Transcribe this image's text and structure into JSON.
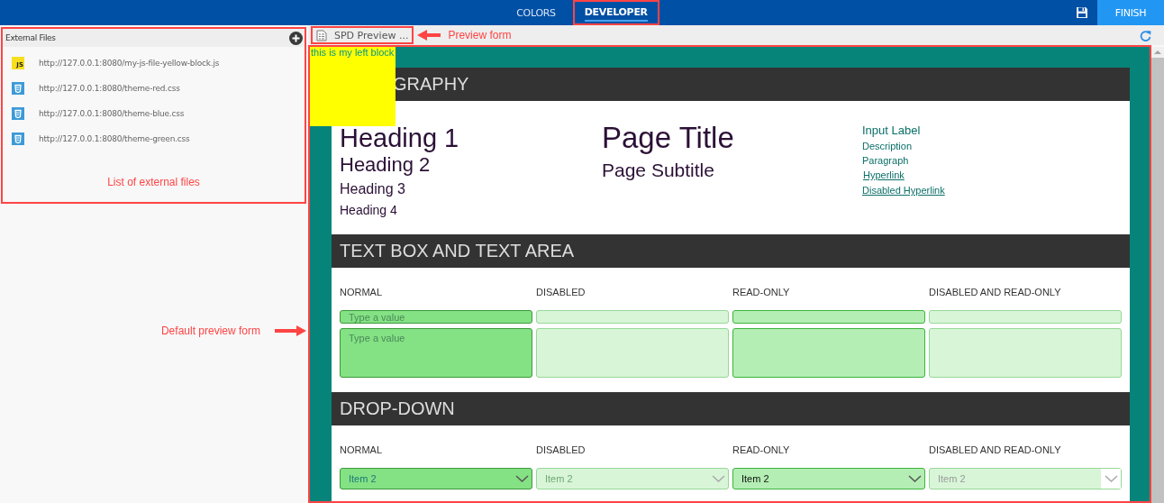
{
  "topbar": {
    "tabs": [
      {
        "label": "COLORS",
        "selected": false,
        "highlighted": false
      },
      {
        "label": "DEVELOPER",
        "selected": true,
        "highlighted": true
      }
    ],
    "finish_button": "FINISH"
  },
  "external_files": {
    "title": "External Files",
    "highlighted": true,
    "files": [
      {
        "kind": "js",
        "badge": "JS",
        "url": "http://127.0.0.1:8080/my-js-file-yellow-block.js"
      },
      {
        "kind": "css",
        "url": "http://127.0.0.1:8080/theme-red.css"
      },
      {
        "kind": "css",
        "url": "http://127.0.0.1:8080/theme-blue.css"
      },
      {
        "kind": "css",
        "url": "http://127.0.0.1:8080/theme-green.css"
      }
    ],
    "annotation": "List of external files"
  },
  "default_preview_annotation": "Default preview form",
  "preview_tab": {
    "label": "SPD Preview ...",
    "highlighted": true,
    "annotation": "Preview form"
  },
  "preview": {
    "highlighted": true,
    "left_block": "this is my left block",
    "typography": {
      "header": "GRAPHY",
      "headings": [
        "Heading 1",
        "Heading 2",
        "Heading 3",
        "Heading 4"
      ],
      "page_title": "Page Title",
      "page_subtitle": "Page Subtitle",
      "input_label": "Input Label",
      "description": "Description",
      "paragraph": "Paragraph",
      "hyperlink": "Hyperlink",
      "disabled_hyperlink": "Disabled Hyperlink"
    },
    "text_box_section": {
      "header": "TEXT BOX AND TEXT AREA",
      "fields": [
        {
          "label": "NORMAL",
          "disabled": false,
          "readonly": false,
          "placeholder": "Type a value",
          "textarea_placeholder": "Type a value"
        },
        {
          "label": "DISABLED",
          "disabled": true,
          "readonly": false
        },
        {
          "label": "READ-ONLY",
          "disabled": false,
          "readonly": true
        },
        {
          "label": "DISABLED AND READ-ONLY",
          "disabled": true,
          "readonly": true
        }
      ]
    },
    "dropdown_section": {
      "header": "DROP-DOWN",
      "dropdowns": [
        {
          "label": "NORMAL",
          "disabled": false,
          "readonly": false,
          "value": "Item 2"
        },
        {
          "label": "DISABLED",
          "disabled": true,
          "readonly": false,
          "value": "Item 2"
        },
        {
          "label": "READ-ONLY",
          "disabled": false,
          "readonly": true,
          "value": "Item 2"
        },
        {
          "label": "DISABLED AND READ-ONLY",
          "disabled": true,
          "readonly": true,
          "value": "Item 2"
        }
      ]
    }
  }
}
